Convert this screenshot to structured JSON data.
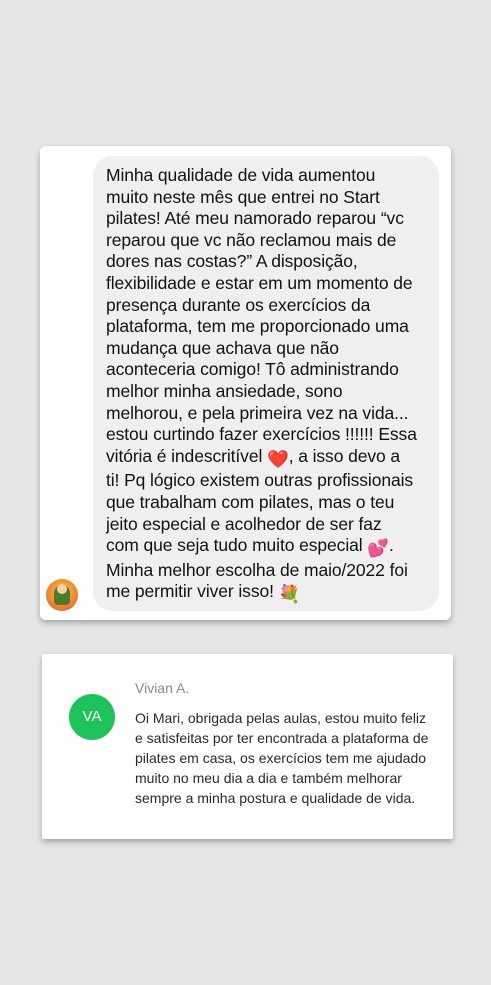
{
  "chat_testimonial": {
    "lines": [
      "Minha qualidade de vida aumentou",
      "muito neste mês que entrei no Start",
      "pilates! Até meu namorado reparou “vc",
      "reparou que vc não reclamou mais de",
      "dores nas costas?” A disposição,",
      "flexibilidade e estar em um momento de",
      "presença durante os exercícios da",
      "plataforma, tem me proporcionado uma",
      "mudança que achava que não",
      "aconteceria comigo! Tô administrando",
      "melhor minha ansiedade, sono",
      "melhorou, e pela primeira vez na vida...",
      "estou curtindo fazer exercícios !!!!!! Essa",
      "vitória é indescritível",
      ", a isso devo a",
      "ti! Pq lógico existem outras profissionais",
      "que trabalham com pilates, mas o teu",
      "jeito especial e acolhedor de ser faz",
      "com que seja tudo muito especial",
      ".",
      "Minha melhor escolha de maio/2022 foi",
      "me permitir viver isso!"
    ],
    "emojis": {
      "heart": "❤️",
      "hearts": "💕",
      "bouquet": "💐"
    }
  },
  "review": {
    "avatar_initials": "VA",
    "name": "Vivian A.",
    "text": "Oi Mari, obrigada pelas aulas, estou muito feliz e satisfeitas por ter encontrada a plataforma de pilates em casa, os exercícios tem me ajudado muito no meu dia a dia e também melhorar sempre a minha postura e qualidade de vida."
  }
}
